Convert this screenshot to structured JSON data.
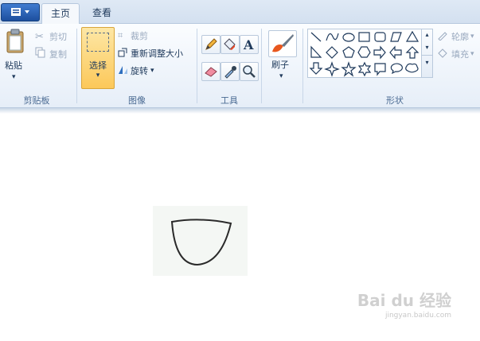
{
  "tabs": {
    "home": "主页",
    "view": "查看"
  },
  "clipboard": {
    "paste": "粘贴",
    "cut": "剪切",
    "copy": "复制",
    "group": "剪贴板"
  },
  "image": {
    "select": "选择",
    "crop": "裁剪",
    "resize": "重新调整大小",
    "rotate": "旋转",
    "group": "图像"
  },
  "tools": {
    "group": "工具"
  },
  "brush": {
    "label": "刷子"
  },
  "shapes": {
    "outline": "轮廓",
    "fill": "填充",
    "group": "形状"
  },
  "watermark": {
    "logo": "Bai du 经验",
    "url": "jingyan.baidu.com"
  },
  "colors": {
    "accent": "#1d4f9e",
    "select_highlight": "#fcd26e"
  }
}
